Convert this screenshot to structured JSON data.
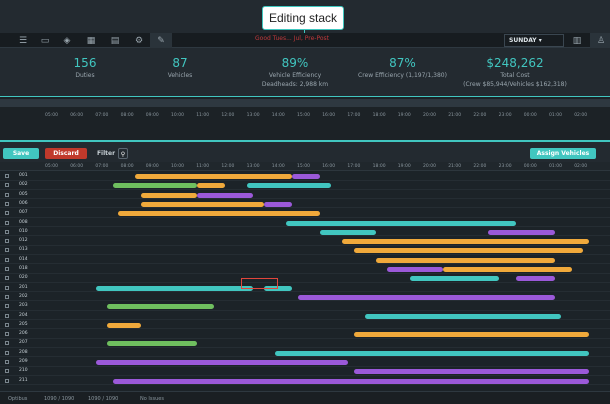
{
  "callout": {
    "label": "Editing stack"
  },
  "toolbar": {
    "alert_text": "Good Tues... Jul, Pre-Post",
    "day": "SUNDAY",
    "icons": [
      "menu-icon",
      "folder-icon",
      "layers-icon",
      "calendar-icon",
      "file-icon",
      "gear-icon",
      "pencil-icon"
    ]
  },
  "stats": {
    "duties": {
      "value": "156",
      "label": "Duties"
    },
    "vehicles": {
      "value": "87",
      "label": "Vehicles"
    },
    "efficiency": {
      "value": "89%",
      "label1": "Vehicle Efficiency",
      "label2": "Deadheads: 2,988 km"
    },
    "crew": {
      "value": "87%",
      "label": "Crew Efficiency (1,197/1,380)"
    },
    "cost": {
      "value": "$248,262",
      "label1": "Total Cost",
      "label2": "(Crew $85,944/Vehicles $162,318)"
    }
  },
  "timeline_hours": [
    "05:00",
    "06:00",
    "07:00",
    "08:00",
    "09:00",
    "10:00",
    "11:00",
    "12:00",
    "13:00",
    "14:00",
    "15:00",
    "16:00",
    "17:00",
    "18:00",
    "19:00",
    "20:00",
    "21:00",
    "22:00",
    "23:00",
    "00:00",
    "01:00",
    "02:00"
  ],
  "actions": {
    "save": "Save",
    "discard": "Discard",
    "filter": "Filter",
    "assign": "Assign Vehicles"
  },
  "rows": [
    {
      "id": "001",
      "bars": [
        [
          0.17,
          0.45,
          "#f0a93b"
        ],
        [
          0.45,
          0.5,
          "#9b59d9"
        ]
      ]
    },
    {
      "id": "002",
      "bars": [
        [
          0.13,
          0.28,
          "#6fbf5f"
        ],
        [
          0.28,
          0.33,
          "#f0a93b"
        ],
        [
          0.37,
          0.52,
          "#41c6c0"
        ]
      ]
    },
    {
      "id": "005",
      "bars": [
        [
          0.18,
          0.28,
          "#f0a93b"
        ],
        [
          0.28,
          0.38,
          "#9b59d9"
        ]
      ]
    },
    {
      "id": "006",
      "bars": [
        [
          0.18,
          0.4,
          "#f0a93b"
        ],
        [
          0.4,
          0.45,
          "#9b59d9"
        ]
      ]
    },
    {
      "id": "007",
      "bars": [
        [
          0.14,
          0.5,
          "#f0a93b"
        ]
      ]
    },
    {
      "id": "008",
      "bars": [
        [
          0.44,
          0.85,
          "#41c6c0"
        ]
      ]
    },
    {
      "id": "010",
      "bars": [
        [
          0.5,
          0.6,
          "#41c6c0"
        ],
        [
          0.8,
          0.92,
          "#9b59d9"
        ]
      ]
    },
    {
      "id": "012",
      "bars": [
        [
          0.54,
          0.98,
          "#f0a93b"
        ]
      ]
    },
    {
      "id": "013",
      "bars": [
        [
          0.56,
          0.97,
          "#f0a93b"
        ]
      ]
    },
    {
      "id": "014",
      "bars": [
        [
          0.6,
          0.92,
          "#f0a93b"
        ]
      ]
    },
    {
      "id": "018",
      "bars": [
        [
          0.62,
          0.72,
          "#9b59d9"
        ],
        [
          0.72,
          0.95,
          "#f0a93b"
        ]
      ]
    },
    {
      "id": "020",
      "bars": [
        [
          0.66,
          0.82,
          "#41c6c0"
        ],
        [
          0.85,
          0.92,
          "#9b59d9"
        ]
      ]
    },
    {
      "id": "201",
      "bars": [
        [
          0.1,
          0.38,
          "#41c6c0"
        ],
        [
          0.4,
          0.45,
          "#41c6c0"
        ]
      ]
    },
    {
      "id": "202",
      "bars": [
        [
          0.46,
          0.92,
          "#9b59d9"
        ]
      ]
    },
    {
      "id": "203",
      "bars": [
        [
          0.12,
          0.31,
          "#6fbf5f"
        ]
      ]
    },
    {
      "id": "204",
      "bars": [
        [
          0.58,
          0.93,
          "#41c6c0"
        ]
      ]
    },
    {
      "id": "205",
      "bars": [
        [
          0.12,
          0.18,
          "#f0a93b"
        ]
      ]
    },
    {
      "id": "206",
      "bars": [
        [
          0.56,
          0.98,
          "#f0a93b"
        ]
      ]
    },
    {
      "id": "207",
      "bars": [
        [
          0.12,
          0.28,
          "#6fbf5f"
        ]
      ]
    },
    {
      "id": "208",
      "bars": [
        [
          0.42,
          0.98,
          "#41c6c0"
        ]
      ]
    },
    {
      "id": "209",
      "bars": [
        [
          0.1,
          0.55,
          "#9b59d9"
        ]
      ]
    },
    {
      "id": "210",
      "bars": [
        [
          0.56,
          0.98,
          "#9b59d9"
        ]
      ]
    },
    {
      "id": "211",
      "bars": [
        [
          0.13,
          0.98,
          "#9b59d9"
        ]
      ]
    }
  ],
  "status": {
    "app": "Optibus",
    "a": "1090 / 1090",
    "b": "1090 / 1090",
    "issues": "No Issues"
  }
}
